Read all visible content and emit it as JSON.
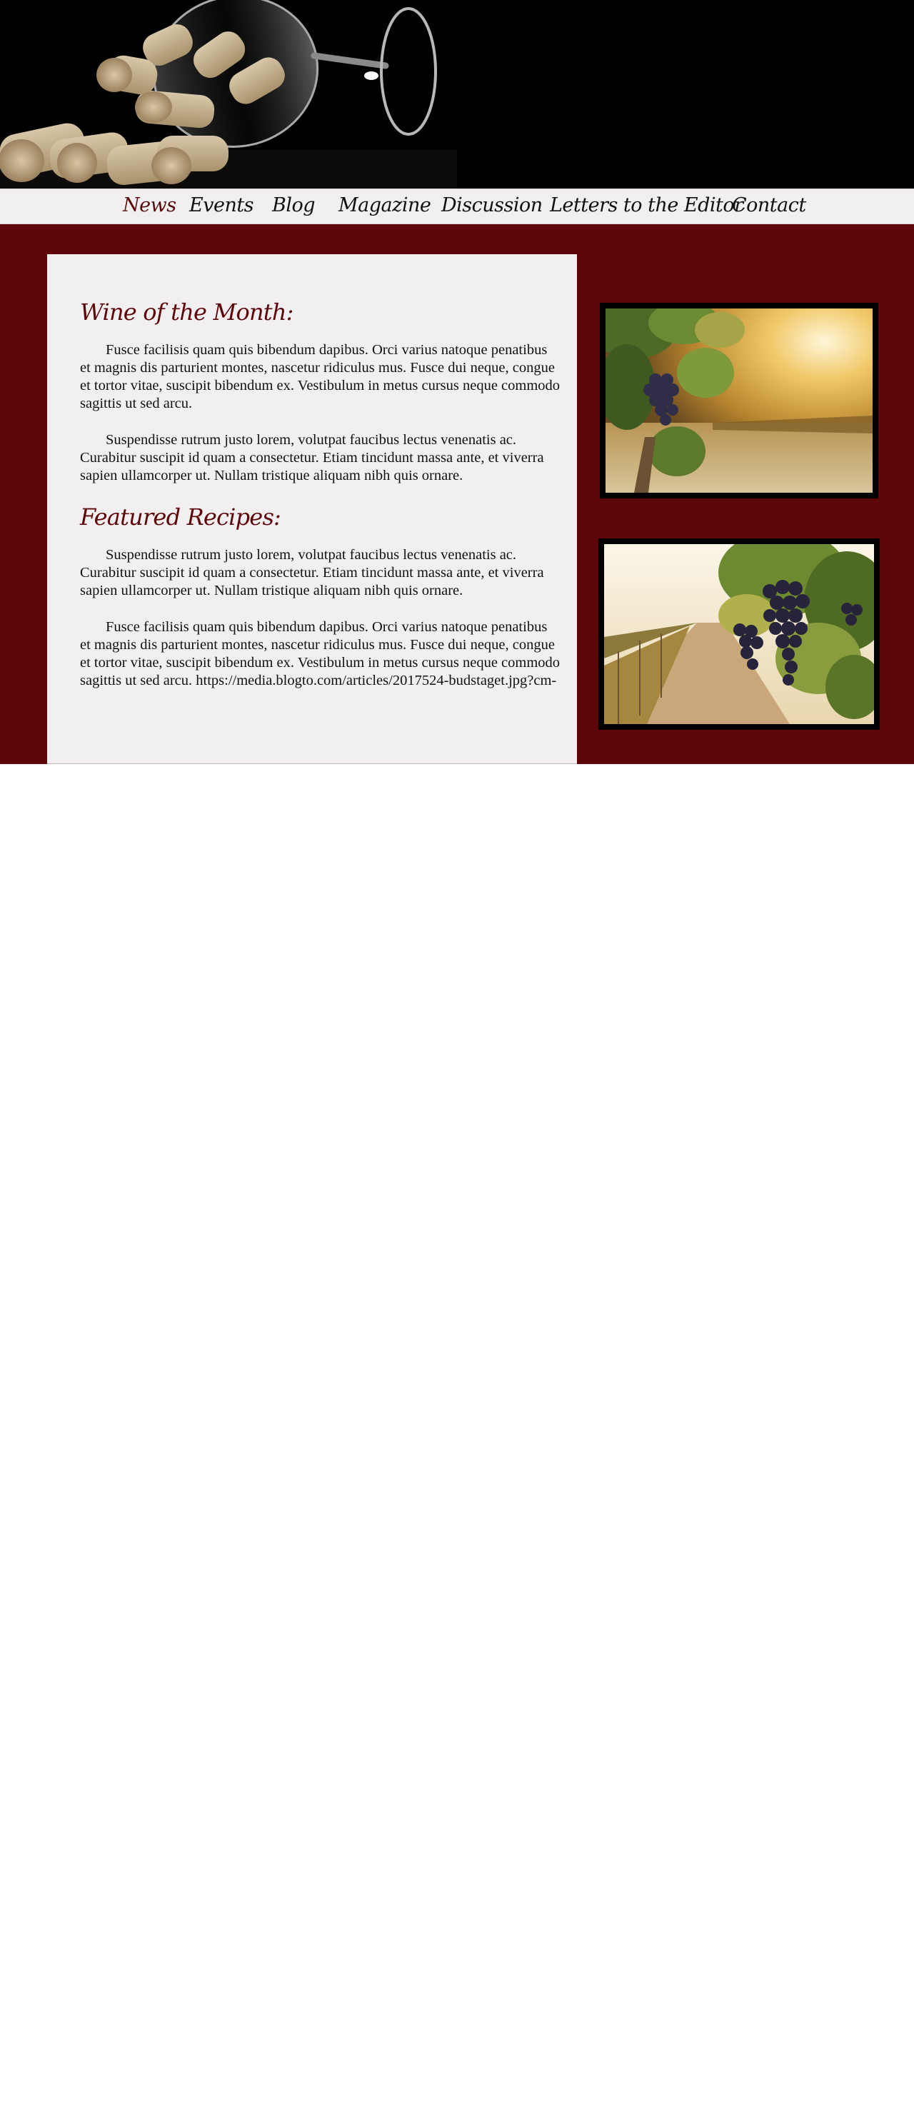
{
  "nav": {
    "items": [
      {
        "label": "News",
        "active": true
      },
      {
        "label": "Events",
        "active": false
      },
      {
        "label": "Blog",
        "active": false
      },
      {
        "label": "Magazine",
        "active": false
      },
      {
        "label": "Discussion",
        "active": false
      },
      {
        "label": "Letters to the Editor",
        "active": false
      },
      {
        "label": "Contact",
        "active": false
      }
    ]
  },
  "sections": [
    {
      "heading": "Wine of the Month:",
      "paragraphs": [
        "Fusce facilisis quam quis bibendum dapibus. Orci varius natoque penatibus et magnis dis parturient montes, nascetur ridiculus mus. Fusce dui neque, congue et tortor vitae, suscipit bibendum ex. Vestibulum in metus cursus neque commodo sagittis ut sed arcu.",
        "Suspendisse rutrum justo lorem, volutpat faucibus lectus venenatis ac. Curabitur suscipit id quam a consectetur. Etiam tincidunt massa ante, et viverra sapien ullamcorper ut. Nullam tristique aliquam nibh quis ornare."
      ]
    },
    {
      "heading": "Featured Recipes:",
      "paragraphs": [
        "Suspendisse rutrum justo lorem, volutpat faucibus lectus venenatis ac. Curabitur suscipit id quam a consectetur. Etiam tincidunt massa ante, et viverra sapien ullamcorper ut. Nullam tristique aliquam nibh quis ornare.",
        "Fusce facilisis quam quis bibendum dapibus. Orci varius natoque penatibus et magnis dis parturient montes, nascetur ridiculus mus. Fusce dui neque, congue et tortor vitae, suscipit bibendum ex. Vestibulum in metus cursus neque commodo sagittis ut sed arcu. https://media.blogto.com/articles/2017524-budstaget.jpg?cm-"
      ]
    }
  ],
  "colors": {
    "maroon": "#5e070a",
    "panel": "#f1eff0"
  }
}
